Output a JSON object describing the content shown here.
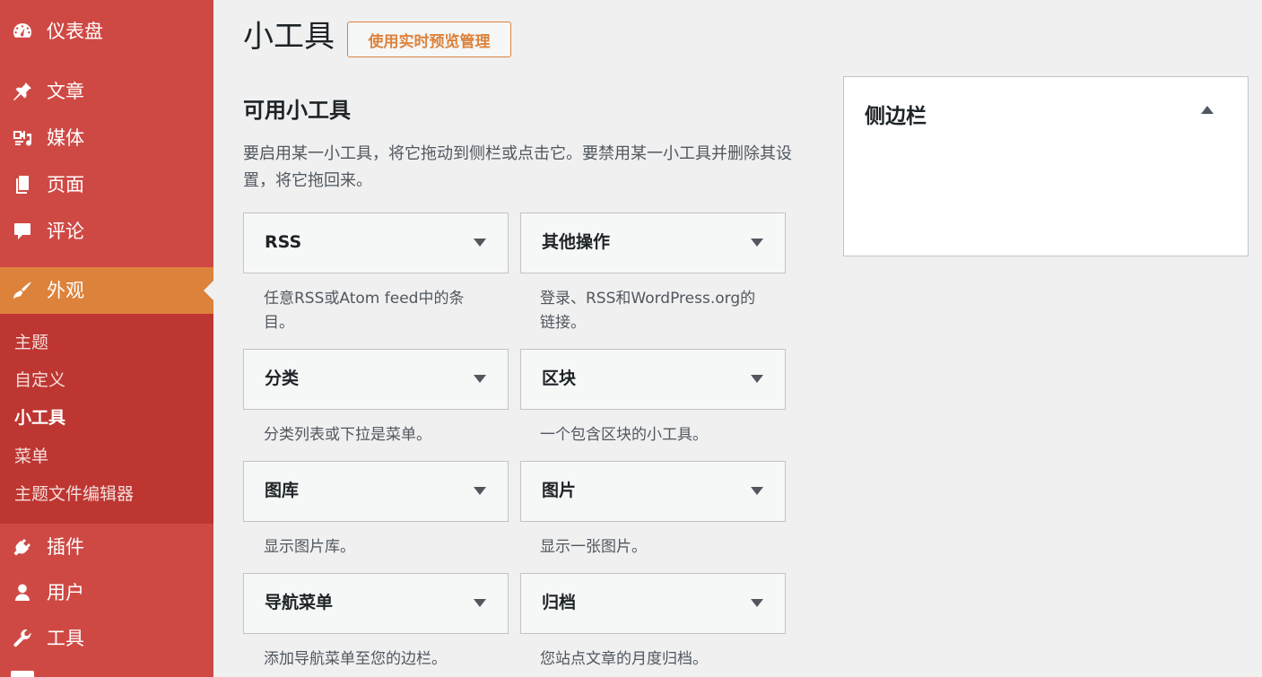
{
  "menu": {
    "dashboard": "仪表盘",
    "posts": "文章",
    "media": "媒体",
    "pages": "页面",
    "comments": "评论",
    "appearance": "外观",
    "plugins": "插件",
    "users": "用户",
    "tools": "工具"
  },
  "submenu": {
    "themes": "主题",
    "customize": "自定义",
    "widgets": "小工具",
    "menus": "菜单",
    "theme_editor": "主题文件编辑器"
  },
  "page": {
    "title": "小工具",
    "preview_button": "使用实时预览管理",
    "available_heading": "可用小工具",
    "available_desc": "要启用某一小工具，将它拖动到侧栏或点击它。要禁用某一小工具并删除其设置，将它拖回来。"
  },
  "widgets": [
    {
      "title": "RSS",
      "desc": "任意RSS或Atom feed中的条目。"
    },
    {
      "title": "其他操作",
      "desc": "登录、RSS和WordPress.org的链接。"
    },
    {
      "title": "分类",
      "desc": "分类列表或下拉是菜单。"
    },
    {
      "title": "区块",
      "desc": "一个包含区块的小工具。"
    },
    {
      "title": "图库",
      "desc": "显示图片库。"
    },
    {
      "title": "图片",
      "desc": "显示一张图片。"
    },
    {
      "title": "导航菜单",
      "desc": "添加导航菜单至您的边栏。"
    },
    {
      "title": "归档",
      "desc": "您站点文章的月度归档。"
    }
  ],
  "sidebar_area": {
    "title": "侧边栏"
  },
  "colors": {
    "menu_bg": "#cf4944",
    "submenu_bg": "#be3631",
    "menu_highlight": "#dd823b",
    "page_bg": "#f0f0f1"
  },
  "icons": {
    "dashboard": "dashboard-icon",
    "posts": "pushpin-icon",
    "media": "media-icon",
    "pages": "pages-icon",
    "comments": "comment-icon",
    "appearance": "paintbrush-icon",
    "plugins": "plugin-icon",
    "users": "user-icon",
    "tools": "wrench-icon"
  }
}
